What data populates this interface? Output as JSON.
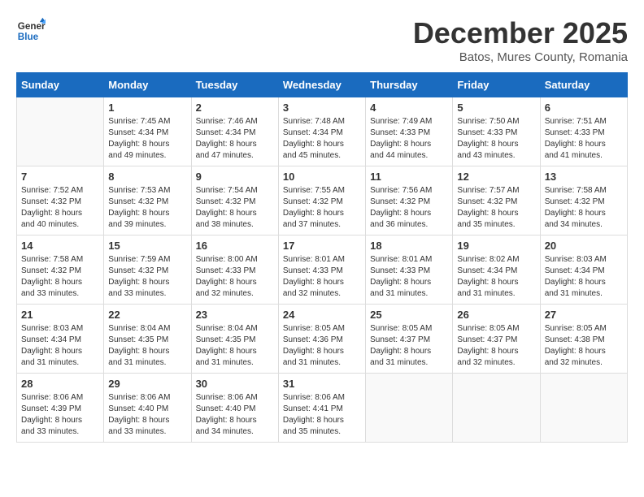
{
  "logo": {
    "line1": "General",
    "line2": "Blue"
  },
  "title": "December 2025",
  "subtitle": "Batos, Mures County, Romania",
  "weekdays": [
    "Sunday",
    "Monday",
    "Tuesday",
    "Wednesday",
    "Thursday",
    "Friday",
    "Saturday"
  ],
  "weeks": [
    [
      {
        "day": "",
        "info": ""
      },
      {
        "day": "1",
        "info": "Sunrise: 7:45 AM\nSunset: 4:34 PM\nDaylight: 8 hours\nand 49 minutes."
      },
      {
        "day": "2",
        "info": "Sunrise: 7:46 AM\nSunset: 4:34 PM\nDaylight: 8 hours\nand 47 minutes."
      },
      {
        "day": "3",
        "info": "Sunrise: 7:48 AM\nSunset: 4:34 PM\nDaylight: 8 hours\nand 45 minutes."
      },
      {
        "day": "4",
        "info": "Sunrise: 7:49 AM\nSunset: 4:33 PM\nDaylight: 8 hours\nand 44 minutes."
      },
      {
        "day": "5",
        "info": "Sunrise: 7:50 AM\nSunset: 4:33 PM\nDaylight: 8 hours\nand 43 minutes."
      },
      {
        "day": "6",
        "info": "Sunrise: 7:51 AM\nSunset: 4:33 PM\nDaylight: 8 hours\nand 41 minutes."
      }
    ],
    [
      {
        "day": "7",
        "info": "Sunrise: 7:52 AM\nSunset: 4:32 PM\nDaylight: 8 hours\nand 40 minutes."
      },
      {
        "day": "8",
        "info": "Sunrise: 7:53 AM\nSunset: 4:32 PM\nDaylight: 8 hours\nand 39 minutes."
      },
      {
        "day": "9",
        "info": "Sunrise: 7:54 AM\nSunset: 4:32 PM\nDaylight: 8 hours\nand 38 minutes."
      },
      {
        "day": "10",
        "info": "Sunrise: 7:55 AM\nSunset: 4:32 PM\nDaylight: 8 hours\nand 37 minutes."
      },
      {
        "day": "11",
        "info": "Sunrise: 7:56 AM\nSunset: 4:32 PM\nDaylight: 8 hours\nand 36 minutes."
      },
      {
        "day": "12",
        "info": "Sunrise: 7:57 AM\nSunset: 4:32 PM\nDaylight: 8 hours\nand 35 minutes."
      },
      {
        "day": "13",
        "info": "Sunrise: 7:58 AM\nSunset: 4:32 PM\nDaylight: 8 hours\nand 34 minutes."
      }
    ],
    [
      {
        "day": "14",
        "info": "Sunrise: 7:58 AM\nSunset: 4:32 PM\nDaylight: 8 hours\nand 33 minutes."
      },
      {
        "day": "15",
        "info": "Sunrise: 7:59 AM\nSunset: 4:32 PM\nDaylight: 8 hours\nand 33 minutes."
      },
      {
        "day": "16",
        "info": "Sunrise: 8:00 AM\nSunset: 4:33 PM\nDaylight: 8 hours\nand 32 minutes."
      },
      {
        "day": "17",
        "info": "Sunrise: 8:01 AM\nSunset: 4:33 PM\nDaylight: 8 hours\nand 32 minutes."
      },
      {
        "day": "18",
        "info": "Sunrise: 8:01 AM\nSunset: 4:33 PM\nDaylight: 8 hours\nand 31 minutes."
      },
      {
        "day": "19",
        "info": "Sunrise: 8:02 AM\nSunset: 4:34 PM\nDaylight: 8 hours\nand 31 minutes."
      },
      {
        "day": "20",
        "info": "Sunrise: 8:03 AM\nSunset: 4:34 PM\nDaylight: 8 hours\nand 31 minutes."
      }
    ],
    [
      {
        "day": "21",
        "info": "Sunrise: 8:03 AM\nSunset: 4:34 PM\nDaylight: 8 hours\nand 31 minutes."
      },
      {
        "day": "22",
        "info": "Sunrise: 8:04 AM\nSunset: 4:35 PM\nDaylight: 8 hours\nand 31 minutes."
      },
      {
        "day": "23",
        "info": "Sunrise: 8:04 AM\nSunset: 4:35 PM\nDaylight: 8 hours\nand 31 minutes."
      },
      {
        "day": "24",
        "info": "Sunrise: 8:05 AM\nSunset: 4:36 PM\nDaylight: 8 hours\nand 31 minutes."
      },
      {
        "day": "25",
        "info": "Sunrise: 8:05 AM\nSunset: 4:37 PM\nDaylight: 8 hours\nand 31 minutes."
      },
      {
        "day": "26",
        "info": "Sunrise: 8:05 AM\nSunset: 4:37 PM\nDaylight: 8 hours\nand 32 minutes."
      },
      {
        "day": "27",
        "info": "Sunrise: 8:05 AM\nSunset: 4:38 PM\nDaylight: 8 hours\nand 32 minutes."
      }
    ],
    [
      {
        "day": "28",
        "info": "Sunrise: 8:06 AM\nSunset: 4:39 PM\nDaylight: 8 hours\nand 33 minutes."
      },
      {
        "day": "29",
        "info": "Sunrise: 8:06 AM\nSunset: 4:40 PM\nDaylight: 8 hours\nand 33 minutes."
      },
      {
        "day": "30",
        "info": "Sunrise: 8:06 AM\nSunset: 4:40 PM\nDaylight: 8 hours\nand 34 minutes."
      },
      {
        "day": "31",
        "info": "Sunrise: 8:06 AM\nSunset: 4:41 PM\nDaylight: 8 hours\nand 35 minutes."
      },
      {
        "day": "",
        "info": ""
      },
      {
        "day": "",
        "info": ""
      },
      {
        "day": "",
        "info": ""
      }
    ]
  ]
}
